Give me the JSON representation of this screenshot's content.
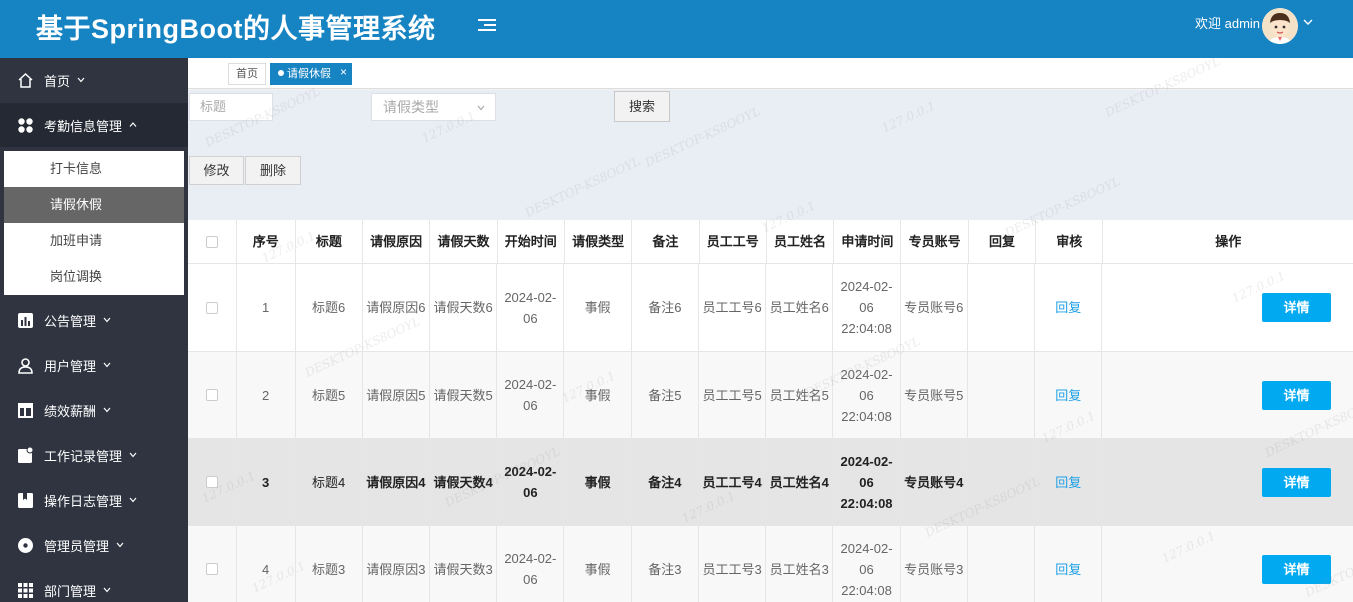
{
  "header": {
    "title": "基于SpringBoot的人事管理系统",
    "welcome": "欢迎 admin"
  },
  "sidebar": {
    "items": [
      {
        "label": "首页",
        "icon": "home-icon"
      },
      {
        "label": "考勤信息管理",
        "icon": "grid-dots-icon",
        "open": true
      },
      {
        "label": "公告管理",
        "icon": "chart-icon"
      },
      {
        "label": "用户管理",
        "icon": "user-icon"
      },
      {
        "label": "绩效薪酬",
        "icon": "layout-icon"
      },
      {
        "label": "工作记录管理",
        "icon": "note-icon"
      },
      {
        "label": "操作日志管理",
        "icon": "bookmark-icon"
      },
      {
        "label": "管理员管理",
        "icon": "circle-icon"
      },
      {
        "label": "部门管理",
        "icon": "apps-icon"
      }
    ],
    "submenu": [
      "打卡信息",
      "请假休假",
      "加班申请",
      "岗位调换"
    ],
    "active_sub": "请假休假"
  },
  "tabs": [
    {
      "label": "首页",
      "active": false
    },
    {
      "label": "请假休假",
      "active": true
    }
  ],
  "filters": {
    "title_placeholder": "标题",
    "type_placeholder": "请假类型",
    "search_label": "搜索"
  },
  "actions": {
    "edit_label": "修改",
    "delete_label": "删除"
  },
  "table": {
    "columns": [
      "序号",
      "标题",
      "请假原因",
      "请假天数",
      "开始时间",
      "请假类型",
      "备注",
      "员工工号",
      "员工姓名",
      "申请时间",
      "专员账号",
      "回复",
      "审核",
      "操作"
    ],
    "rows": [
      {
        "no": "1",
        "title": "标题6",
        "reason": "请假原因6",
        "days": "请假天数6",
        "start": "2024-02-06",
        "type": "事假",
        "note": "备注6",
        "emp_no": "员工工号6",
        "emp_name": "员工姓名6",
        "apply_time": "2024-02-06 22:04:08",
        "account": "专员账号6",
        "reply": "",
        "audit": "回复",
        "op": "详情"
      },
      {
        "no": "2",
        "title": "标题5",
        "reason": "请假原因5",
        "days": "请假天数5",
        "start": "2024-02-06",
        "type": "事假",
        "note": "备注5",
        "emp_no": "员工工号5",
        "emp_name": "员工姓名5",
        "apply_time": "2024-02-06 22:04:08",
        "account": "专员账号5",
        "reply": "",
        "audit": "回复",
        "op": "详情"
      },
      {
        "no": "3",
        "title": "标题4",
        "reason": "请假原因4",
        "days": "请假天数4",
        "start": "2024-02-06",
        "type": "事假",
        "note": "备注4",
        "emp_no": "员工工号4",
        "emp_name": "员工姓名4",
        "apply_time": "2024-02-06 22:04:08",
        "account": "专员账号4",
        "reply": "",
        "audit": "回复",
        "op": "详情"
      },
      {
        "no": "4",
        "title": "标题3",
        "reason": "请假原因3",
        "days": "请假天数3",
        "start": "2024-02-06",
        "type": "事假",
        "note": "备注3",
        "emp_no": "员工工号3",
        "emp_name": "员工姓名3",
        "apply_time": "2024-02-06 22:04:08",
        "account": "专员账号3",
        "reply": "",
        "audit": "回复",
        "op": "详情"
      }
    ]
  },
  "watermark": {
    "ip": "127.0.0.1",
    "host": "DESKTOP-KS8OOYL"
  },
  "colors": {
    "header": "#1683c2",
    "sidebar": "#2f3440",
    "accent": "#00a9f0",
    "link": "#1ea0e6"
  }
}
